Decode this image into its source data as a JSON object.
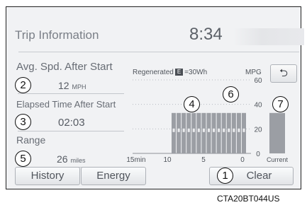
{
  "header": {
    "title": "Trip Information",
    "clock": "8:34"
  },
  "stats": {
    "avg_speed": {
      "label": "Avg. Spd. After Start",
      "value": "12",
      "unit": "MPH",
      "callout": "2"
    },
    "elapsed": {
      "label": "Elapsed Time After Start",
      "value": "02:03",
      "callout": "3"
    },
    "range": {
      "label": "Range",
      "value": "26",
      "unit": "miles",
      "callout": "5"
    }
  },
  "graph": {
    "regen_label": "Regenerated",
    "regen_icon_text": "E",
    "regen_suffix": "=30Wh",
    "unit_label": "MPG",
    "callouts": {
      "history": "4",
      "latest": "6",
      "current": "7"
    },
    "back_icon": "return-arrow-icon"
  },
  "buttons": {
    "history": "History",
    "energy": "Energy",
    "clear": "Clear",
    "clear_callout": "1"
  },
  "caption": "CTA20BT044US",
  "colors": {
    "bar": "#9b9ea4",
    "panel": "#f1f2f4",
    "text": "#676c74"
  },
  "chart_data": {
    "type": "bar",
    "title": "",
    "xlabel": "",
    "ylabel": "MPG",
    "ylim": [
      0,
      60
    ],
    "y_ticks": [
      "0",
      "20",
      "40",
      "60"
    ],
    "x_ticks": [
      "15min",
      "10",
      "5",
      "0"
    ],
    "history_values": [
      33,
      33,
      33,
      33,
      33,
      33,
      33,
      33,
      33,
      33,
      33,
      33,
      33,
      33,
      33
    ],
    "regen_per_bar": 1,
    "current_label": "Current",
    "current_value": 33
  }
}
